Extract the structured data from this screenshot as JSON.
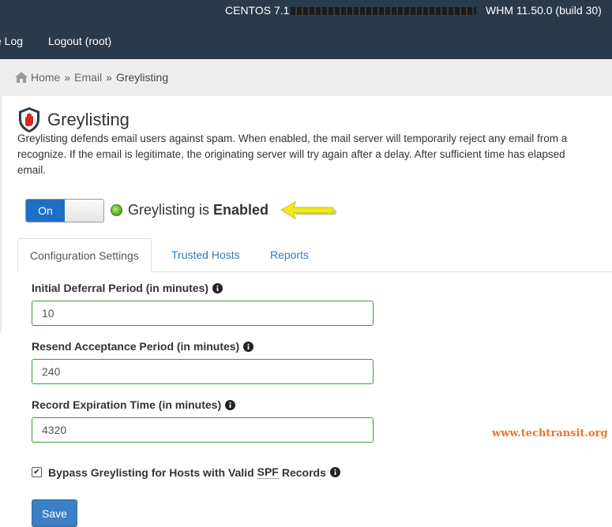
{
  "header": {
    "os_prefix": "CENTOS 7.1",
    "whm_version": "WHM 11.50.0 (build 30)",
    "nav_log": "e Log",
    "nav_logout": "Logout (root)"
  },
  "breadcrumb": {
    "home": "Home",
    "email": "Email",
    "current": "Greylisting",
    "separator": "»"
  },
  "page": {
    "title": "Greylisting",
    "description_lines": [
      "Greylisting defends email users against spam. When enabled, the mail server will temporarily reject any email from a",
      "recognize. If the email is legitimate, the originating server will try again after a delay. After sufficient time has elapsed",
      "email."
    ]
  },
  "toggle": {
    "on_label": "On",
    "state": "on"
  },
  "status": {
    "prefix": "Greylisting is ",
    "value": "Enabled",
    "color": "#4aa81c"
  },
  "tabs": [
    {
      "label": "Configuration Settings",
      "active": true
    },
    {
      "label": "Trusted Hosts",
      "active": false
    },
    {
      "label": "Reports",
      "active": false
    }
  ],
  "form": {
    "fields": [
      {
        "label": "Initial Deferral Period (in minutes)",
        "value": "10"
      },
      {
        "label": "Resend Acceptance Period (in minutes)",
        "value": "240"
      },
      {
        "label": "Record Expiration Time (in minutes)",
        "value": "4320"
      }
    ],
    "bypass": {
      "prefix": "Bypass Greylisting for Hosts with Valid",
      "spf": "SPF",
      "suffix": "Records",
      "checked": true
    },
    "save_label": "Save"
  },
  "watermark": "www.techtransit.org",
  "colors": {
    "header_bg": "#293a4a",
    "primary": "#1e6fc4",
    "link": "#337ab7",
    "input_border": "#3c9a3c",
    "arrow": "#f2e81a"
  }
}
